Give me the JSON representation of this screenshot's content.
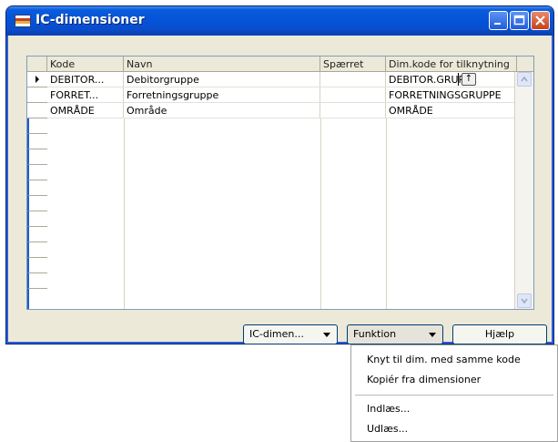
{
  "window": {
    "title": "IC-dimensioner"
  },
  "grid": {
    "columns": [
      "Kode",
      "Navn",
      "Spærret",
      "Dim.kode for tilknytning"
    ],
    "rows": [
      {
        "code": "DEBITOR...",
        "name": "Debitorgruppe",
        "blocked": "",
        "dim_code": "DEBITOR.GRUPPE"
      },
      {
        "code": "FORRET...",
        "name": "Forretningsgruppe",
        "blocked": "",
        "dim_code": "FORRETNINGSGRUPPE"
      },
      {
        "code": "OMRÅDE",
        "name": "Område",
        "blocked": "",
        "dim_code": "OMRÅDE"
      }
    ],
    "lookup_glyph": "↑"
  },
  "buttons": {
    "ic_dim": "IC-dimen...",
    "function": "Funktion",
    "help": "Hjælp"
  },
  "menu": {
    "items": [
      "Knyt til dim. med samme kode",
      "Kopiér fra dimensioner",
      "Indlæs...",
      "Udlæs..."
    ]
  }
}
